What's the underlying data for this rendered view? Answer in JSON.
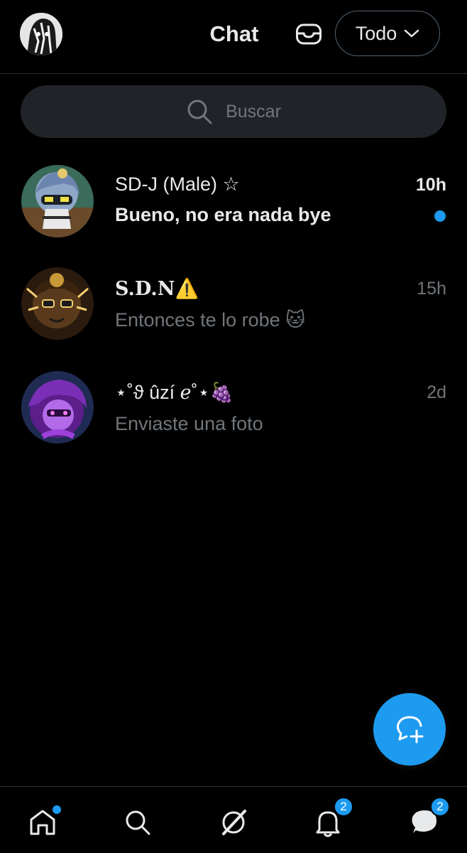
{
  "header": {
    "title": "Chat",
    "filter_label": "Todo"
  },
  "search": {
    "placeholder": "Buscar"
  },
  "conversations": [
    {
      "name": "SD-J (Male) ☆",
      "time": "10h",
      "preview": "Bueno, no era nada bye",
      "unread": true,
      "avatar_colors": [
        "#3b6b5a",
        "#8fa7c7"
      ]
    },
    {
      "name": "S.D.N⚠️",
      "time": "15h",
      "preview": "Entonces te lo robe 🐱",
      "unread": false,
      "avatar_colors": [
        "#2b1a0e",
        "#d8a63c"
      ]
    },
    {
      "name": "⋆˚ϑ ûzí ℯ˚⋆🍇",
      "time": "2d",
      "preview": "Enviaste una foto",
      "unread": false,
      "avatar_colors": [
        "#1f2b52",
        "#9b40d8"
      ]
    }
  ],
  "bottom_nav": {
    "home_icon": "home-icon",
    "search_icon": "search-icon",
    "grok_icon": "grok-icon",
    "notifications_badge": "2",
    "messages_badge": "2"
  },
  "colors": {
    "accent": "#1d9bf0",
    "background": "#000000",
    "muted_text": "#71767b",
    "primary_text": "#e7e9ea",
    "divider": "#2f3336"
  }
}
